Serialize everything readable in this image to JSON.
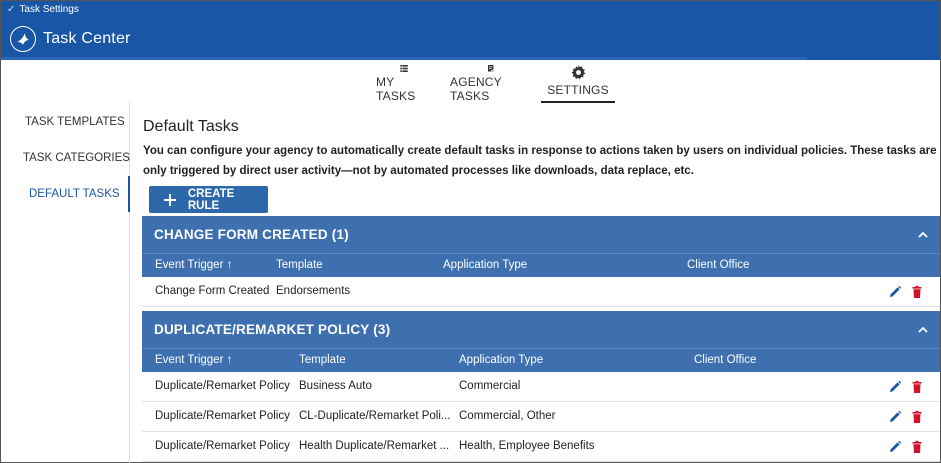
{
  "window": {
    "title": "Task Settings"
  },
  "app": {
    "name": "Task Center"
  },
  "topnav": {
    "items": [
      {
        "label": "MY TASKS",
        "icon": "list-icon"
      },
      {
        "label": "AGENCY TASKS",
        "icon": "clipboard-check-icon"
      },
      {
        "label": "SETTINGS",
        "icon": "gear-icon",
        "active": true
      }
    ]
  },
  "sidebar": {
    "items": [
      {
        "label": "TASK TEMPLATES"
      },
      {
        "label": "TASK CATEGORIES"
      },
      {
        "label": "DEFAULT TASKS",
        "active": true
      }
    ]
  },
  "main": {
    "title": "Default Tasks",
    "description": "You can configure your agency to automatically create default tasks in response to actions taken by users on individual policies. These tasks are only triggered by direct user activity—not by automated processes like downloads, data replace, etc.",
    "create_button": "CREATE RULE",
    "columns": [
      "Event Trigger",
      "Template",
      "Application Type",
      "Client Office"
    ],
    "groups": [
      {
        "title": "CHANGE FORM CREATED (1)",
        "rows": [
          {
            "event": "Change Form Created",
            "template": "Endorsements",
            "app_type": "",
            "office": ""
          }
        ]
      },
      {
        "title": "DUPLICATE/REMARKET POLICY (3)",
        "rows": [
          {
            "event": "Duplicate/Remarket Policy",
            "template": "Business Auto",
            "app_type": "Commercial",
            "office": ""
          },
          {
            "event": "Duplicate/Remarket Policy",
            "template": "CL-Duplicate/Remarket Poli...",
            "app_type": "Commercial, Other",
            "office": ""
          },
          {
            "event": "Duplicate/Remarket Policy",
            "template": "Health Duplicate/Remarket ...",
            "app_type": "Health, Employee Benefits",
            "office": ""
          }
        ]
      }
    ]
  },
  "colors": {
    "brand": "#1a56a6",
    "group_header": "#3e70b0",
    "delete": "#d0122c",
    "edit": "#1a56a6"
  }
}
